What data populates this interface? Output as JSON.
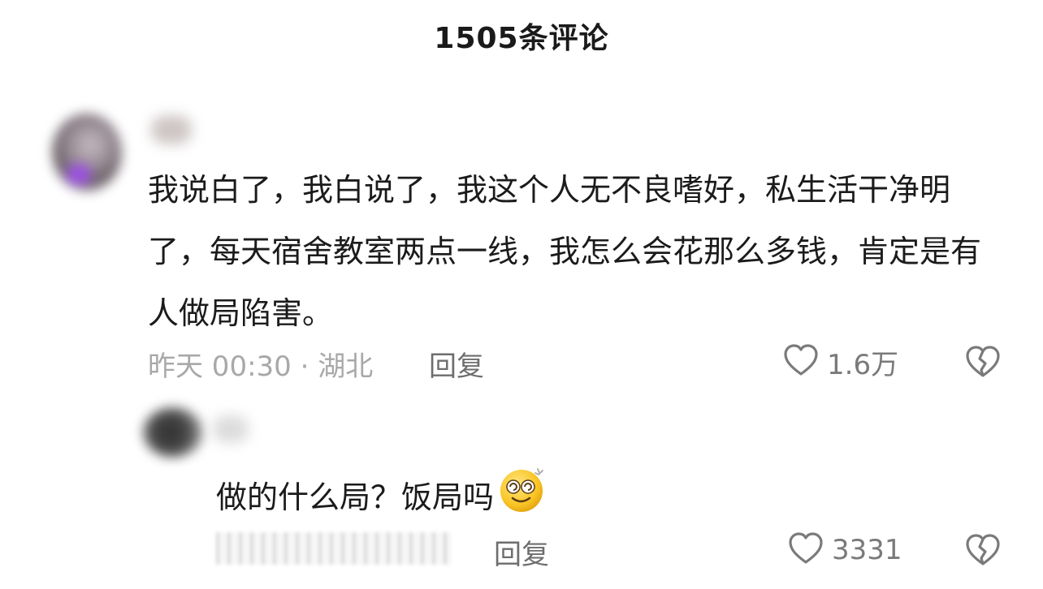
{
  "header": {
    "title": "1505条评论"
  },
  "comments": [
    {
      "text": "我说白了，我白说了，我这个人无不良嗜好，私生活干净明了，每天宿舍教室两点一线，我怎么会花那么多钱，肯定是有人做局陷害。",
      "time_location": "昨天 00:30 · 湖北",
      "reply_label": "回复",
      "like_count": "1.6万",
      "accent_color": "#9a52e0"
    }
  ],
  "replies": [
    {
      "text": "做的什么局？饭局吗",
      "emoji": "dizzy-face-emoji",
      "reply_label": "回复",
      "like_count": "3331"
    }
  ],
  "icons": {
    "like": "heart-icon",
    "dislike": "broken-heart-icon"
  }
}
